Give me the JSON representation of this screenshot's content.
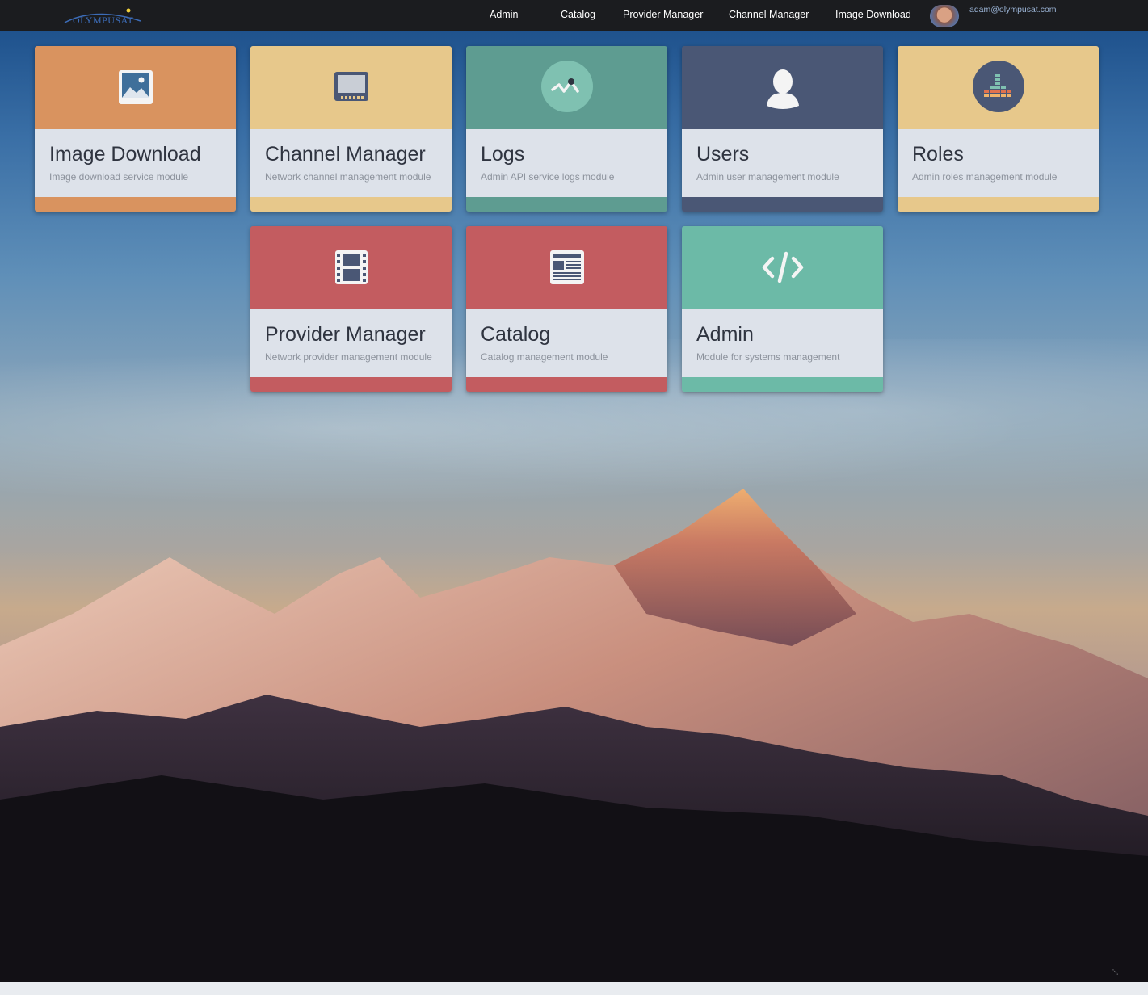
{
  "nav": {
    "logo_text": "OLYMPUSAT",
    "items": [
      {
        "label": "Admin"
      },
      {
        "label": "Catalog"
      },
      {
        "label": "Provider Manager"
      },
      {
        "label": "Channel Manager"
      },
      {
        "label": "Image Download"
      }
    ],
    "user_email": "adam@olympusat.com"
  },
  "tiles": [
    {
      "title": "Image Download",
      "description": "Image download service module",
      "icon": "image-icon",
      "color": "#d9935f"
    },
    {
      "title": "Channel Manager",
      "description": "Network channel management module",
      "icon": "monitor-icon",
      "color": "#e7c88b"
    },
    {
      "title": "Logs",
      "description": "Admin API service logs module",
      "icon": "activity-icon",
      "color": "#5e9c91"
    },
    {
      "title": "Users",
      "description": "Admin user management module",
      "icon": "user-icon",
      "color": "#4a5775"
    },
    {
      "title": "Roles",
      "description": "Admin roles management module",
      "icon": "equalizer-icon",
      "color": "#e7c88b"
    },
    {
      "title": "Provider Manager",
      "description": "Network provider management module",
      "icon": "film-icon",
      "color": "#c35c60"
    },
    {
      "title": "Catalog",
      "description": "Catalog management module",
      "icon": "newspaper-icon",
      "color": "#c35c60"
    },
    {
      "title": "Admin",
      "description": "Module for systems management",
      "icon": "code-icon",
      "color": "#6cbaa7"
    }
  ]
}
